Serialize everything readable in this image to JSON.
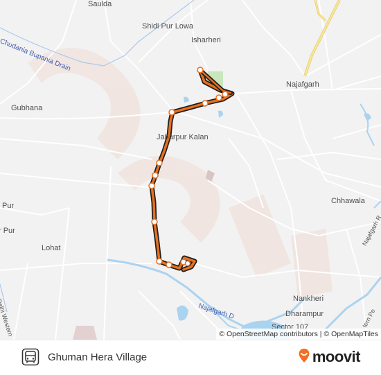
{
  "map": {
    "labels": {
      "saulda": "Saulda",
      "shidi_pur_lowa": "Shidi Pur Lowa",
      "isharheri": "Isharheri",
      "chudania_drain": "Chudania Bupania Drain",
      "najafgarh": "Najafgarh",
      "gubhana": "Gubhana",
      "jatarpur_kalan": "Jaharpur Kalan",
      "chhawala": "Chhawala",
      "pur_1": "Pur",
      "pur_2": "r Pur",
      "lohat": "Lohat",
      "nankheri": "Nankheri",
      "dharampur": "Dharampur",
      "sector_107": "Sector 107",
      "najafgarh_drain": "Najafgarh D",
      "delhi_western": "Delhi Western",
      "najafgarh_road_right": "Najafgarh R",
      "western_periphery": "tern Pe"
    },
    "watermark": "moovit",
    "attribution": "© OpenStreetMap contributors | © OpenMapTiles",
    "colors": {
      "background": "#f2f2f2",
      "route_outer": "#1f1f1f",
      "route_inner": "#e8701e",
      "stop_fill": "#ffffff",
      "stop_stroke": "#e8701e",
      "water": "#aad3f0",
      "park": "#c9e6bd",
      "highway": "#f5e39a"
    }
  },
  "footer": {
    "icon": "bus-icon",
    "route_name": "Ghuman Hera Village",
    "brand_icon": "moovit-pin-icon",
    "brand_name": "moovit"
  }
}
